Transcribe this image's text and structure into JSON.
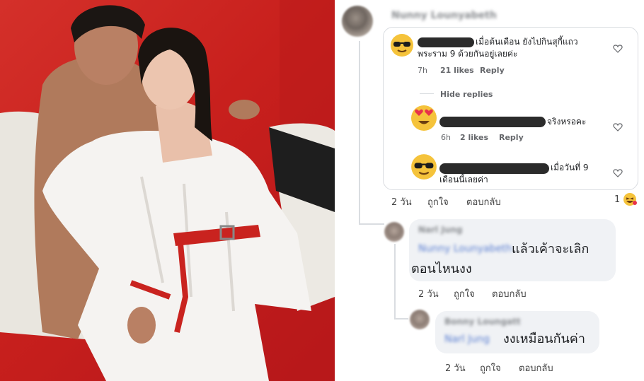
{
  "comments": [
    {
      "text_line1": "เมื่อต้นเดือน ยังไปกินสุกี้แถว",
      "text_line2": "พระราม 9 ด้วยกันอยู่เลยค่ะ",
      "time": "7h",
      "likes": "21 likes",
      "reply": "Reply",
      "emoji": "sunglasses-emoji"
    },
    {
      "hide_replies": "Hide replies"
    },
    {
      "text_line1": "จริงหรอคะ",
      "time": "6h",
      "likes": "2 likes",
      "reply": "Reply",
      "emoji": "heart-eyes-emoji"
    },
    {
      "text_line1": "เมื่อวันที่ 9",
      "text_line2": "เดือนนี้เลยค่า",
      "emoji": "sunglasses-emoji"
    },
    {
      "time": "2 วัน",
      "like": "ถูกใจ",
      "reply": "ตอบกลับ",
      "reaction_count": "1",
      "reaction_emoji": "haha-reaction"
    },
    {
      "author": "Narl Jung",
      "mention": "Nunny Lounyabeth",
      "text_line1": "แล้วเค้าจะเลิก",
      "text_line2": "ตอนไหนงง",
      "time": "2 วัน",
      "like": "ถูกใจ",
      "reply": "ตอบกลับ"
    },
    {
      "author": "Bonny Loungatt",
      "mention": "Narl Jung",
      "text": "งงเหมือนกันค่า",
      "time": "2 วัน",
      "like": "ถูกใจ",
      "reply": "ตอบกลับ"
    }
  ],
  "top_author": "Nunny Lounyabeth",
  "colors": {
    "background_red": "#c8201d",
    "link_blue": "#5b7fd1",
    "meta_gray": "#65676b",
    "bubble_gray": "#f0f2f5"
  }
}
